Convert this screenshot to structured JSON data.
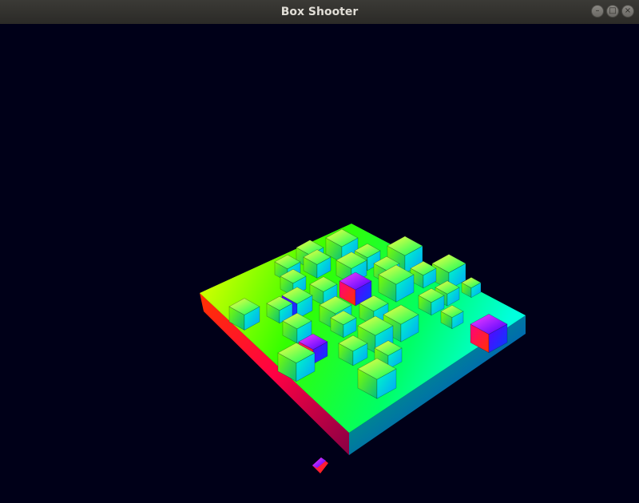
{
  "window": {
    "title": "Box Shooter",
    "controls": {
      "minimize": "–",
      "maximize": "□",
      "close": "×"
    }
  },
  "scene": {
    "background": "#000018",
    "platform": {
      "top_gradient": [
        "#ffff00",
        "#33ff00",
        "#00ffdd"
      ],
      "side_gradient": [
        "#ff0044",
        "#00ff00",
        "#0022ff"
      ]
    },
    "box_palette": [
      "#00ff80",
      "#40ff40",
      "#00e0ff",
      "#8000ff",
      "#ff00a0",
      "#20ff20"
    ]
  }
}
